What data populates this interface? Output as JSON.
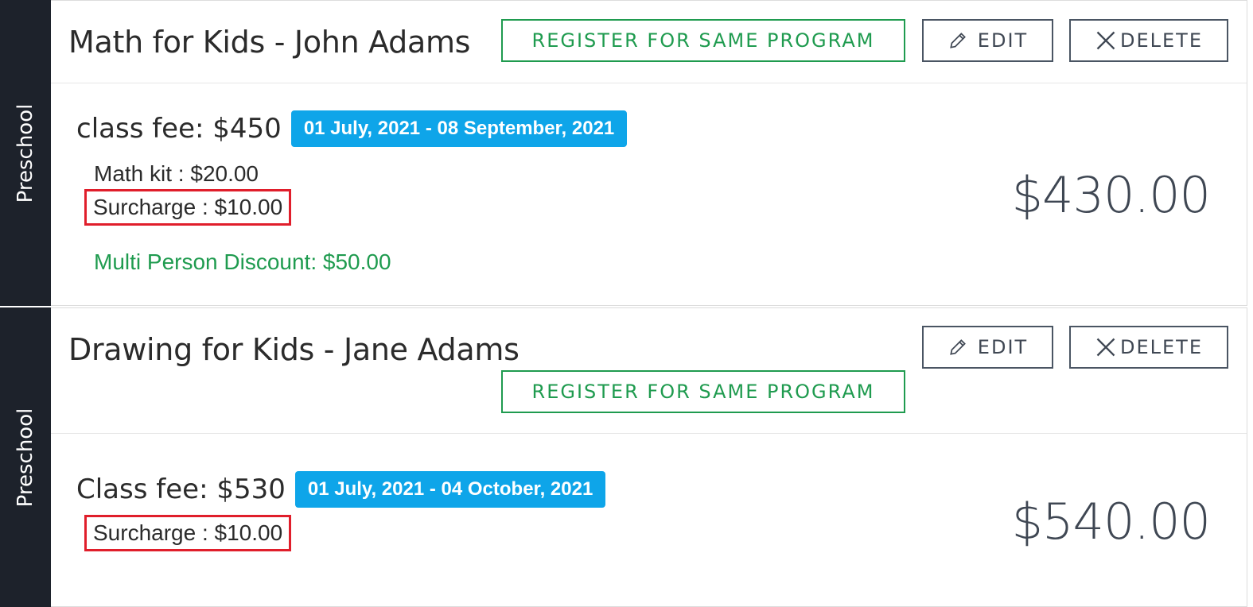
{
  "registrations": [
    {
      "category": "Preschool",
      "title": "Math for Kids - John Adams",
      "register_label": "REGISTER FOR SAME PROGRAM",
      "edit_label": "EDIT",
      "delete_label": "DELETE",
      "fee_text": "class fee: $450",
      "date_range": "01 July, 2021 - 08 September, 2021",
      "items": [
        "Math kit : $20.00"
      ],
      "surcharge": "Surcharge : $10.00",
      "discount": "Multi Person Discount: $50.00",
      "total": "$430.00"
    },
    {
      "category": "Preschool",
      "title": "Drawing for Kids - Jane Adams",
      "register_label": "REGISTER FOR SAME PROGRAM",
      "edit_label": "EDIT",
      "delete_label": "DELETE",
      "fee_text": "Class fee: $530",
      "date_range": "01 July, 2021 - 04 October, 2021",
      "surcharge": "Surcharge : $10.00",
      "total": "$540.00"
    }
  ],
  "icons": {
    "edit": "pencil-icon",
    "delete": "close-icon"
  },
  "colors": {
    "sidebar": "#1d222b",
    "badge": "#0ea5e9",
    "success": "#1f9b4f",
    "highlight": "#e01e2b"
  }
}
